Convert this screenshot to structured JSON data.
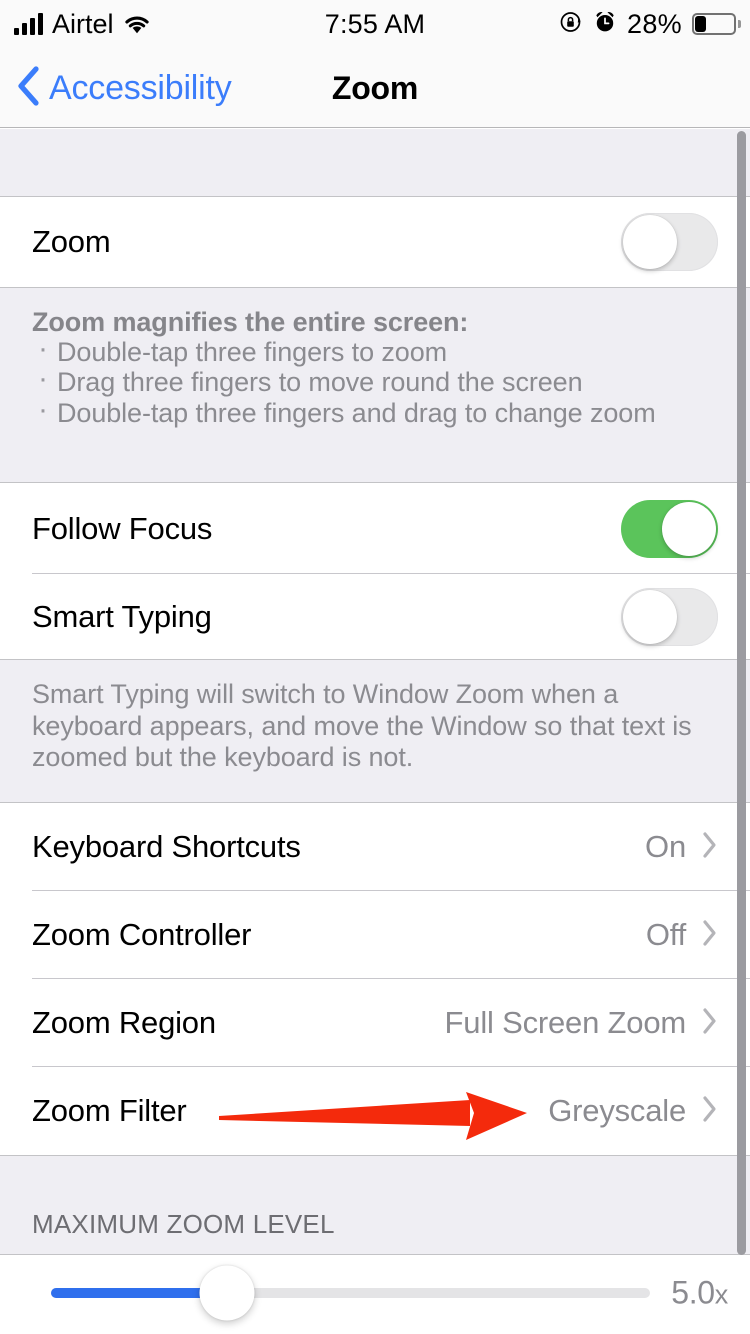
{
  "status_bar": {
    "carrier": "Airtel",
    "time": "7:55 AM",
    "battery_percent": "28%",
    "signal_bars": 4,
    "icons": [
      "signal-bars-icon",
      "wifi-icon",
      "rotation-lock-icon",
      "alarm-clock-icon",
      "battery-icon"
    ]
  },
  "nav": {
    "back_label": "Accessibility",
    "title": "Zoom",
    "accent_color": "#3b7dfb"
  },
  "sections": {
    "zoom_toggle": {
      "label": "Zoom",
      "state": "off"
    },
    "zoom_footer": {
      "title": "Zoom magnifies the entire screen:",
      "bullets": [
        "Double-tap three fingers to zoom",
        "Drag three fingers to move round the screen",
        "Double-tap three fingers and drag to change zoom"
      ]
    },
    "follow_focus": {
      "label": "Follow Focus",
      "state": "on"
    },
    "smart_typing": {
      "label": "Smart Typing",
      "state": "off"
    },
    "smart_typing_footer": {
      "text": "Smart Typing will switch to Window Zoom when a keyboard appears, and move the Window so that text is zoomed but the keyboard is not."
    },
    "detail_rows": [
      {
        "label": "Keyboard Shortcuts",
        "value": "On"
      },
      {
        "label": "Zoom Controller",
        "value": "Off"
      },
      {
        "label": "Zoom Region",
        "value": "Full Screen Zoom"
      },
      {
        "label": "Zoom Filter",
        "value": "Greyscale"
      }
    ],
    "max_zoom": {
      "header": "MAXIMUM ZOOM LEVEL",
      "value": "5.0",
      "unit": "x",
      "fill_percent": 29
    }
  },
  "annotation": {
    "type": "arrow",
    "color": "#f42a0c",
    "points_to": "Zoom Filter value Greyscale"
  },
  "colors": {
    "toggle_on": "#5bc45b",
    "toggle_off": "#e9e9ea",
    "slider_fill": "#2f6fed",
    "group_background": "#efeef3",
    "value_text": "#8b8b90"
  }
}
